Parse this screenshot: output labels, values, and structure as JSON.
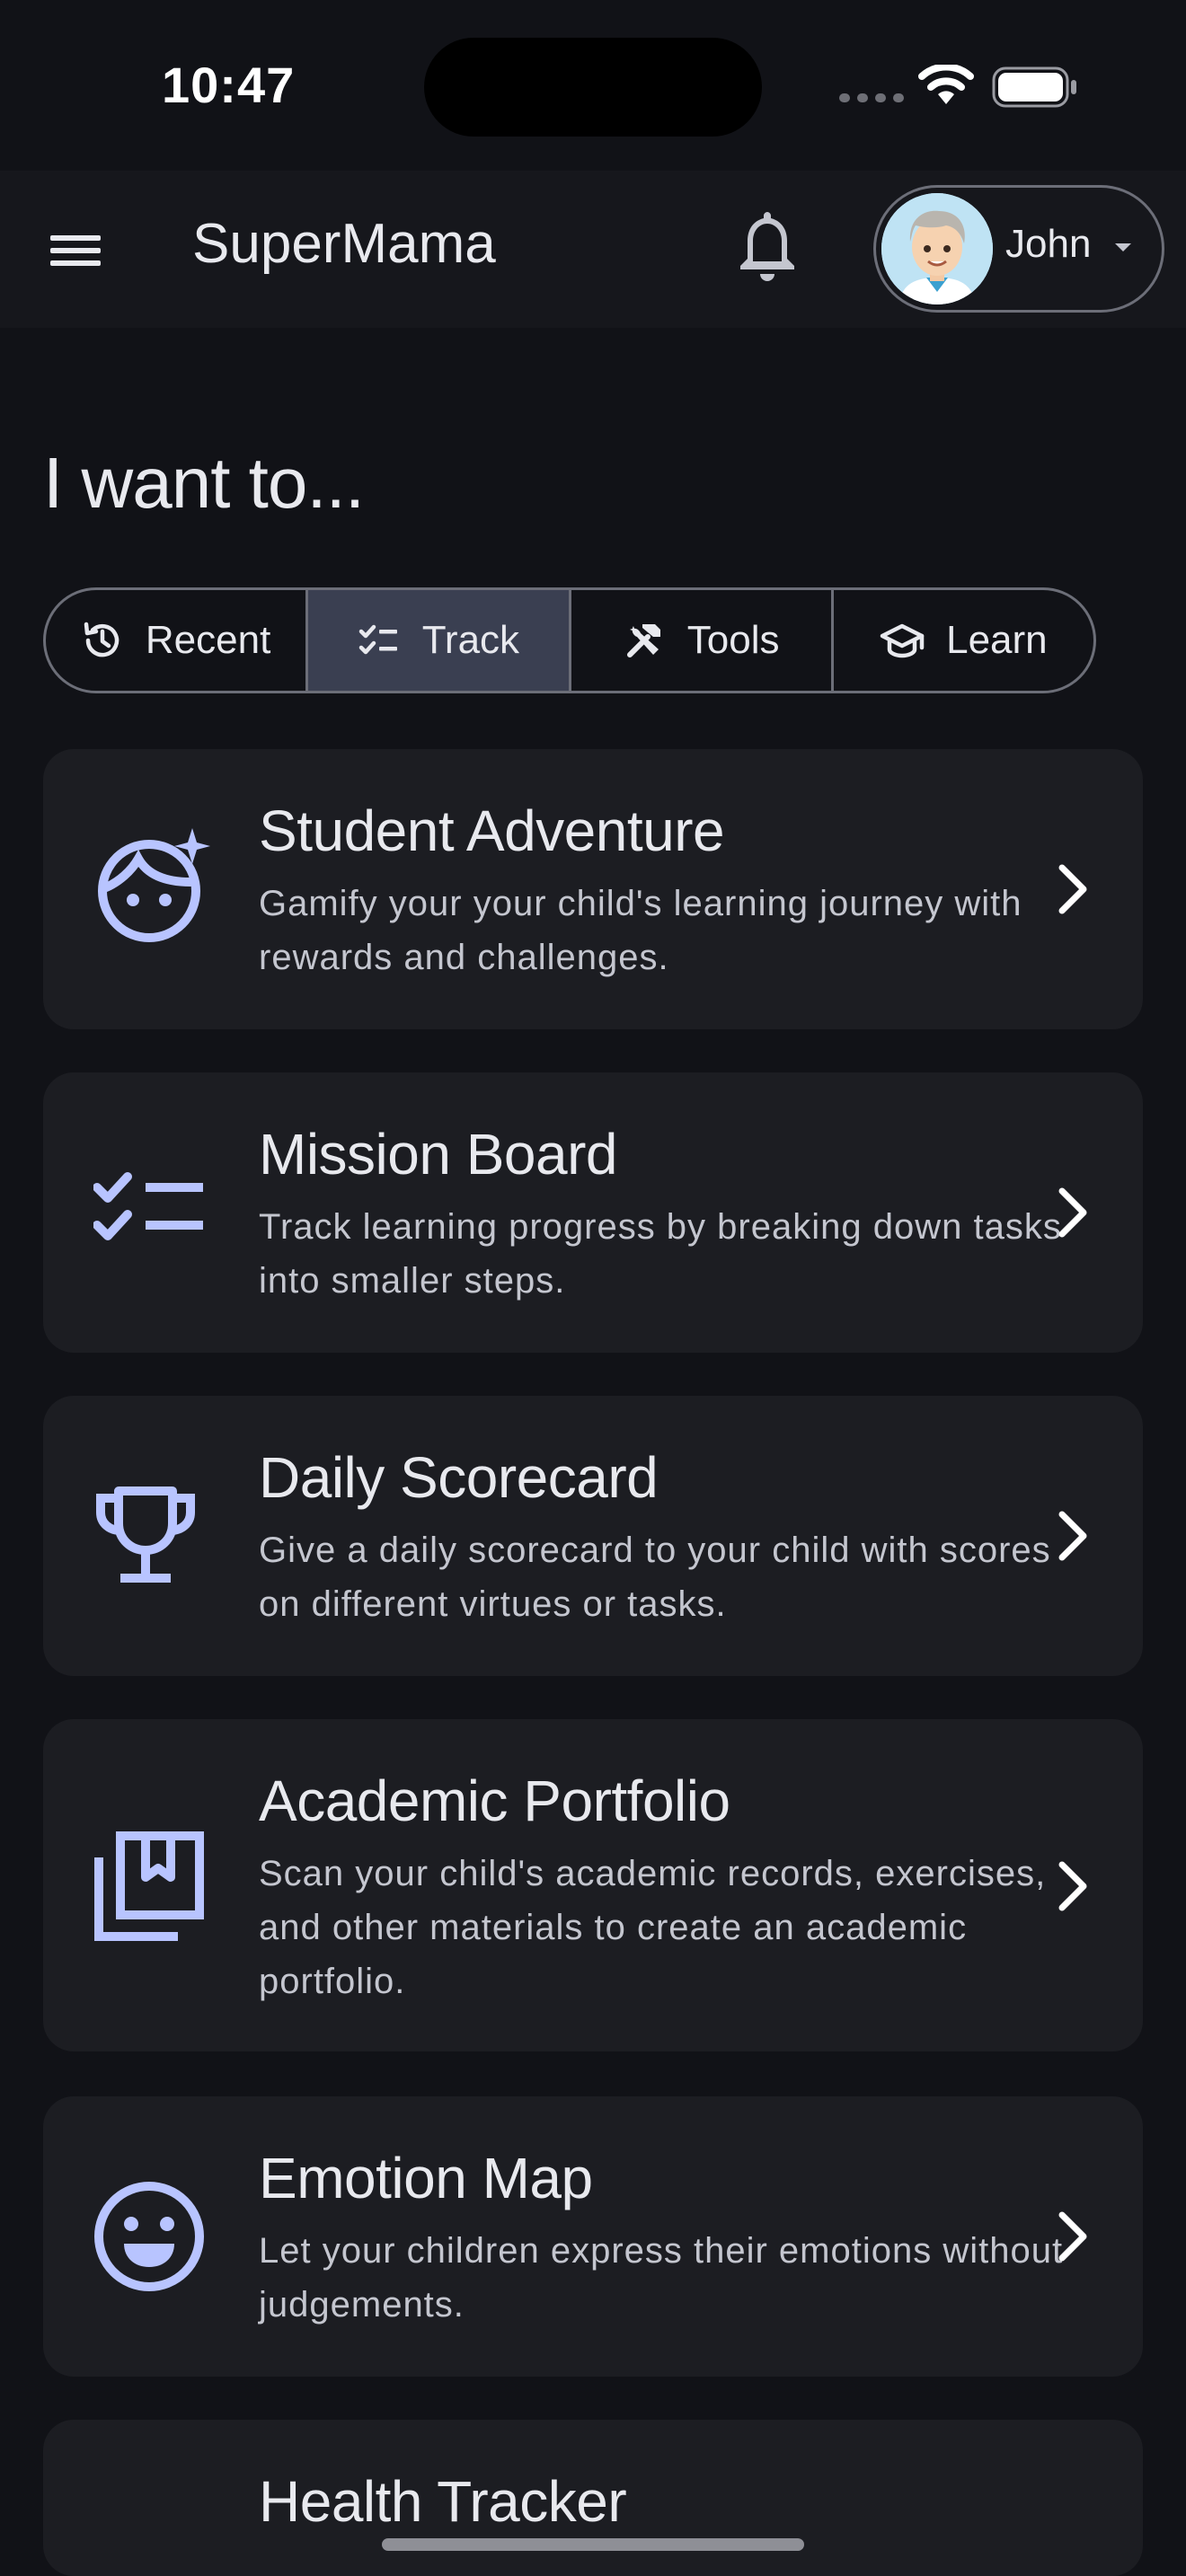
{
  "status_bar": {
    "time": "10:47",
    "signal_icon": "cellular-dots-icon",
    "wifi_icon": "wifi-icon",
    "battery_icon": "battery-icon"
  },
  "app_bar": {
    "menu_icon": "hamburger-menu-icon",
    "title": "SuperMama",
    "notification_icon": "bell-icon",
    "user": {
      "name": "John",
      "avatar": "boy-avatar"
    }
  },
  "heading": "I want to...",
  "tabs": [
    {
      "label": "Recent",
      "icon": "history-icon",
      "active": false
    },
    {
      "label": "Track",
      "icon": "checklist-icon",
      "active": true
    },
    {
      "label": "Tools",
      "icon": "tools-icon",
      "active": false
    },
    {
      "label": "Learn",
      "icon": "graduation-cap-icon",
      "active": false
    }
  ],
  "cards": [
    {
      "title": "Student Adventure",
      "description": "Gamify your your child's learning journey with rewards and challenges.",
      "icon": "face-sparkle-icon"
    },
    {
      "title": "Mission Board",
      "description": "Track learning progress by breaking down tasks into smaller steps.",
      "icon": "checklist-icon"
    },
    {
      "title": "Daily Scorecard",
      "description": "Give a daily scorecard to your child with scores on different virtues or tasks.",
      "icon": "trophy-icon"
    },
    {
      "title": "Academic Portfolio",
      "description": "Scan your child's academic records, exercises, and other materials to create an academic portfolio.",
      "icon": "bookmark-collection-icon"
    },
    {
      "title": "Emotion Map",
      "description": "Let your children express their emotions without judgements.",
      "icon": "smiley-icon"
    },
    {
      "title": "Health Tracker",
      "description": "",
      "icon": ""
    }
  ],
  "colors": {
    "background": "#111217",
    "card": "#1c1d22",
    "accent_icon": "#b8c4ff",
    "active_tab": "#3a3f51"
  }
}
